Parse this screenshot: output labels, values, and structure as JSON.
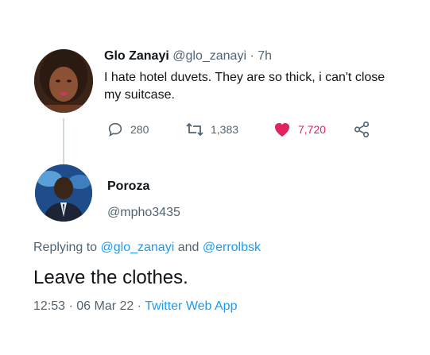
{
  "tweet": {
    "author_name": "Glo Zanayi",
    "author_handle": "@glo_zanayi",
    "separator": "·",
    "age": "7h",
    "text": "I hate hotel duvets.  They are so thick, i can't close my suitcase.",
    "actions": {
      "reply_icon": "reply-icon",
      "reply_count": "280",
      "retweet_icon": "retweet-icon",
      "retweet_count": "1,383",
      "like_icon": "heart-icon",
      "like_count": "7,720",
      "like_color": "#e0245e",
      "share_icon": "share-icon"
    }
  },
  "reply": {
    "author_name": "Poroza",
    "author_handle": "@mpho3435",
    "replying_prefix": "Replying to",
    "replying_user1": "@glo_zanayi",
    "replying_and": "and",
    "replying_user2": "@errolbsk",
    "text": "Leave the clothes.",
    "time": "12:53",
    "dot1": "·",
    "date": "06 Mar 22",
    "dot2": "·",
    "source": "Twitter Web App"
  },
  "colors": {
    "link": "#1d9bf0",
    "secondary_text": "#536471",
    "primary_text": "#0f1419",
    "thread_line": "#cfd9de"
  }
}
